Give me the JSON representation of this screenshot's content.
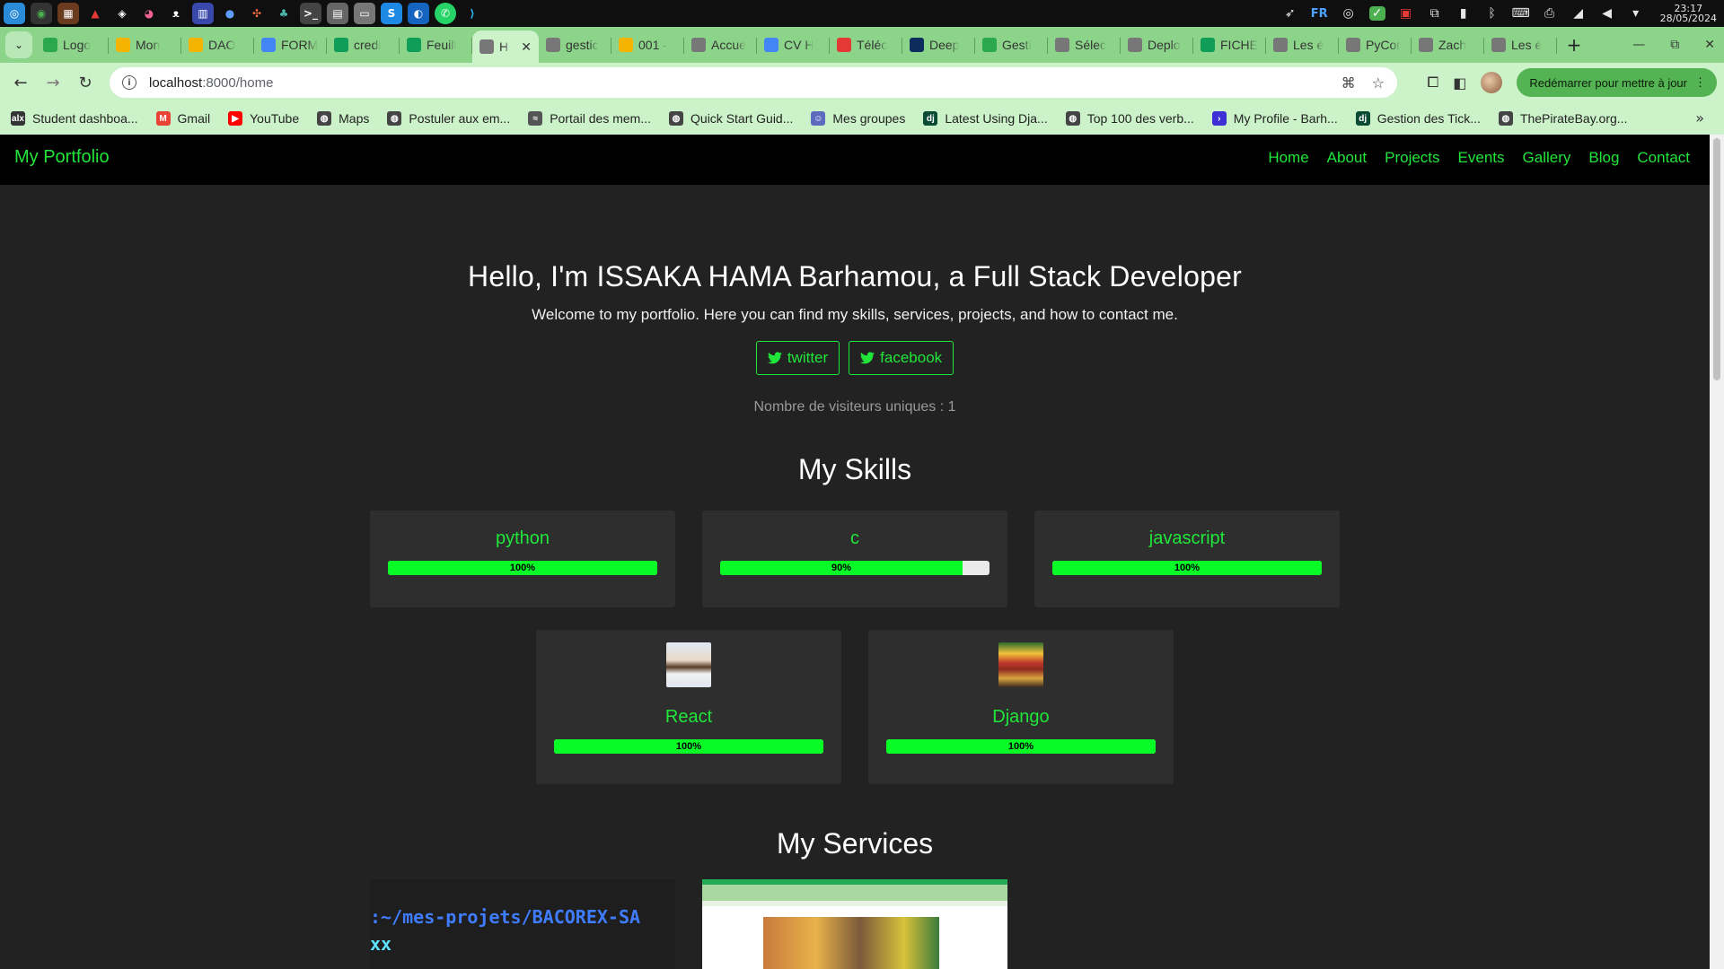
{
  "os": {
    "lang": "FR",
    "time": "23:17",
    "date": "28/05/2024"
  },
  "tabs": [
    {
      "title": "Logo",
      "color": "#2aa84b"
    },
    {
      "title": "Mon",
      "color": "#f4b400"
    },
    {
      "title": "DAO",
      "color": "#f4b400"
    },
    {
      "title": "FORM",
      "color": "#4285f4"
    },
    {
      "title": "credi",
      "color": "#0f9d58"
    },
    {
      "title": "Feuill",
      "color": "#0f9d58"
    },
    {
      "title": "H",
      "color": "#777777",
      "active": true
    },
    {
      "title": "gestic",
      "color": "#777777"
    },
    {
      "title": "001 -",
      "color": "#f4b400"
    },
    {
      "title": "Accue",
      "color": "#777777"
    },
    {
      "title": "CV H",
      "color": "#4285f4"
    },
    {
      "title": "Téléc",
      "color": "#e53935"
    },
    {
      "title": "Deep",
      "color": "#0b2c5c"
    },
    {
      "title": "Gesti",
      "color": "#2aa84b"
    },
    {
      "title": "Sélec",
      "color": "#777777"
    },
    {
      "title": "Deplo",
      "color": "#777777"
    },
    {
      "title": "FICHE",
      "color": "#0f9d58"
    },
    {
      "title": "Les é",
      "color": "#777777"
    },
    {
      "title": "PyCor",
      "color": "#777777"
    },
    {
      "title": "Zach",
      "color": "#777777"
    },
    {
      "title": "Les é",
      "color": "#777777"
    }
  ],
  "toolbar": {
    "url_host": "localhost",
    "url_path": ":8000/home",
    "relaunch_label": "Redémarrer pour mettre à jour"
  },
  "bookmarks": [
    {
      "label": "Student dashboa...",
      "color": "#333333",
      "glyph": "alx"
    },
    {
      "label": "Gmail",
      "color": "#ea4335",
      "glyph": "M"
    },
    {
      "label": "YouTube",
      "color": "#ff0000",
      "glyph": "▶"
    },
    {
      "label": "Maps",
      "color": "#444444",
      "glyph": "◍"
    },
    {
      "label": "Postuler aux em...",
      "color": "#444444",
      "glyph": "◍"
    },
    {
      "label": "Portail des mem...",
      "color": "#555555",
      "glyph": "≈"
    },
    {
      "label": "Quick Start Guid...",
      "color": "#444444",
      "glyph": "◍"
    },
    {
      "label": "Mes groupes",
      "color": "#5c6bc0",
      "glyph": "☺"
    },
    {
      "label": "Latest Using Dja...",
      "color": "#0c4b33",
      "glyph": "dj"
    },
    {
      "label": "Top 100 des verb...",
      "color": "#444444",
      "glyph": "◍"
    },
    {
      "label": "My Profile - Barh...",
      "color": "#3d2fd6",
      "glyph": "›"
    },
    {
      "label": "Gestion des Tick...",
      "color": "#0c4b33",
      "glyph": "dj"
    },
    {
      "label": "ThePirateBay.org...",
      "color": "#444444",
      "glyph": "◍"
    }
  ],
  "site": {
    "brand": "My Portfolio",
    "nav": [
      "Home",
      "About",
      "Projects",
      "Events",
      "Gallery",
      "Blog",
      "Contact"
    ],
    "hero_title": "Hello, I'm ISSAKA HAMA Barhamou, a Full Stack Developer",
    "hero_subtitle": "Welcome to my portfolio. Here you can find my skills, services, projects, and how to contact me.",
    "social": [
      {
        "label": "twitter",
        "icon": "twitter-bird-icon"
      },
      {
        "label": "facebook",
        "icon": "twitter-bird-icon"
      }
    ],
    "visitors": "Nombre de visiteurs uniques : 1",
    "skills_title": "My Skills",
    "skills": [
      {
        "name": "python",
        "percent": 100,
        "label": "100%"
      },
      {
        "name": "c",
        "percent": 90,
        "label": "90%"
      },
      {
        "name": "javascript",
        "percent": 100,
        "label": "100%"
      },
      {
        "name": "React",
        "percent": 100,
        "label": "100%",
        "image": "portrait-photo"
      },
      {
        "name": "Django",
        "percent": 100,
        "label": "100%",
        "image": "assembly-photo"
      }
    ],
    "services_title": "My Services",
    "service_terminal_prefix": "xx",
    "service_terminal_path": ":~/mes-projets/BACOREX-SA"
  },
  "colors": {
    "accent": "#21e63a",
    "bar_fill": "#08fa27",
    "page_bg": "#222222",
    "card_bg": "#2e2e2e",
    "browser_frame": "#8cd48a"
  }
}
